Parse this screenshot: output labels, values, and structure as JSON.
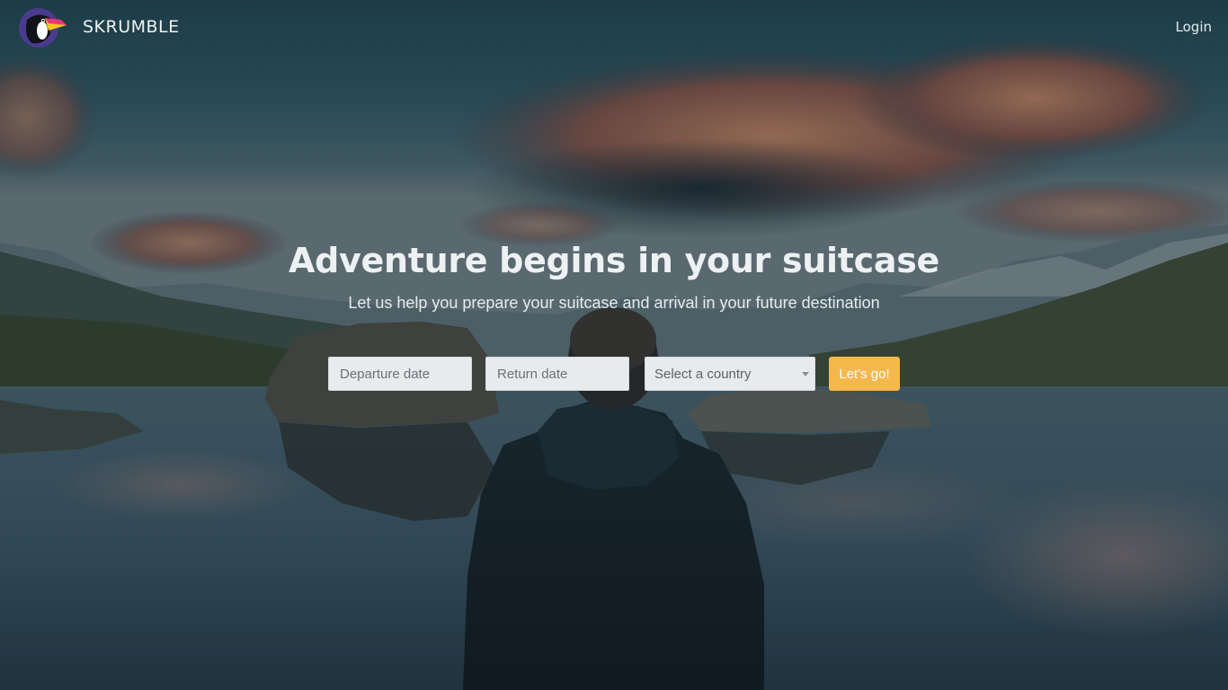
{
  "header": {
    "brand": "SKRUMBLE",
    "login_label": "Login"
  },
  "hero": {
    "title": "Adventure begins in your suitcase",
    "subtitle": "Let us help you prepare your suitcase and arrival in your future destination"
  },
  "form": {
    "departure_placeholder": "Departure date",
    "return_placeholder": "Return date",
    "country_select": {
      "selected": "Select a country"
    },
    "submit_label": "Let's go!"
  },
  "colors": {
    "accent": "#f5b84c",
    "field_bg": "#e8ebee",
    "text_light": "#eef1f3"
  },
  "icons": {
    "logo": "toucan-logo-icon",
    "select_caret": "caret-down-icon"
  }
}
